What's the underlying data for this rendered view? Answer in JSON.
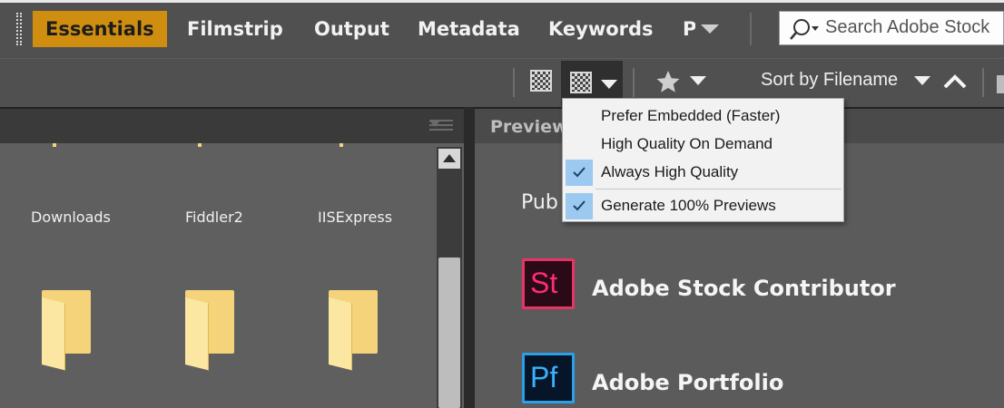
{
  "workspace_tabs": [
    {
      "label": "Essentials",
      "active": true
    },
    {
      "label": "Filmstrip",
      "active": false
    },
    {
      "label": "Output",
      "active": false
    },
    {
      "label": "Metadata",
      "active": false
    },
    {
      "label": "Keywords",
      "active": false
    },
    {
      "label": "P",
      "active": false
    }
  ],
  "search": {
    "placeholder": "Search Adobe Stock"
  },
  "toolbar": {
    "sort_label": "Sort by Filename",
    "icons": [
      "checker-icon",
      "quality-preview-icon",
      "star-icon",
      "sort-ascending-icon"
    ]
  },
  "content": {
    "folders": [
      {
        "label": "Downloads"
      },
      {
        "label": "Fiddler2"
      },
      {
        "label": "IISExpress"
      }
    ]
  },
  "preview": {
    "title": "Preview",
    "pub_label": "Pub",
    "apps": [
      {
        "icon_text": "St",
        "name": "Adobe Stock Contributor",
        "color": "#e73466"
      },
      {
        "icon_text": "Pf",
        "name": "Adobe Portfolio",
        "color": "#2b9fe8"
      }
    ]
  },
  "quality_menu": {
    "items": [
      {
        "label": "Prefer Embedded (Faster)",
        "checked": false
      },
      {
        "label": "High Quality On Demand",
        "checked": false
      },
      {
        "label": "Always High Quality",
        "checked": true
      },
      {
        "label": "Generate 100% Previews",
        "checked": true
      }
    ]
  },
  "colors": {
    "accent": "#d08e10",
    "menu_check": "#9cc9f0"
  }
}
